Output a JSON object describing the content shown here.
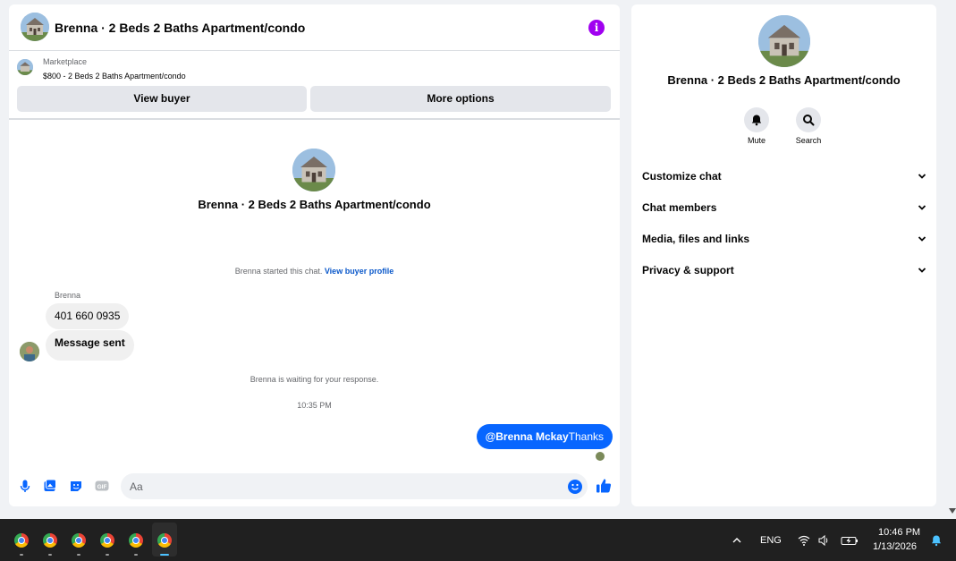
{
  "header": {
    "title": "Brenna · 2 Beds 2 Baths Apartment/condo",
    "info_icon": "i"
  },
  "marketplace": {
    "label": "Marketplace",
    "listing": "$800 - 2 Beds 2 Baths Apartment/condo",
    "view_buyer": "View buyer",
    "more_options": "More options"
  },
  "conversation": {
    "title": "Brenna · 2 Beds 2 Baths Apartment/condo",
    "started_text": "Brenna started this chat. ",
    "started_link": "View buyer profile",
    "sender_name": "Brenna",
    "messages_in": [
      "401 660 0935",
      "Message sent"
    ],
    "waiting_text": "Brenna is waiting for your response.",
    "timestamp": "10:35 PM",
    "message_out_mention": "@Brenna Mckay",
    "message_out_text": "Thanks"
  },
  "composer": {
    "placeholder": "Aa"
  },
  "info_panel": {
    "title": "Brenna · 2 Beds 2 Baths Apartment/condo",
    "mute_label": "Mute",
    "search_label": "Search",
    "sections": [
      "Customize chat",
      "Chat members",
      "Media, files and links",
      "Privacy & support"
    ]
  },
  "taskbar": {
    "apps": [
      "chrome",
      "chrome",
      "chrome",
      "chrome",
      "chrome",
      "chrome"
    ],
    "language": "ENG",
    "time": "10:46 PM",
    "date": "1/13/2026"
  },
  "colors": {
    "accent": "#0866ff",
    "info": "#a000f0",
    "panel_bg": "#f0f2f5"
  }
}
